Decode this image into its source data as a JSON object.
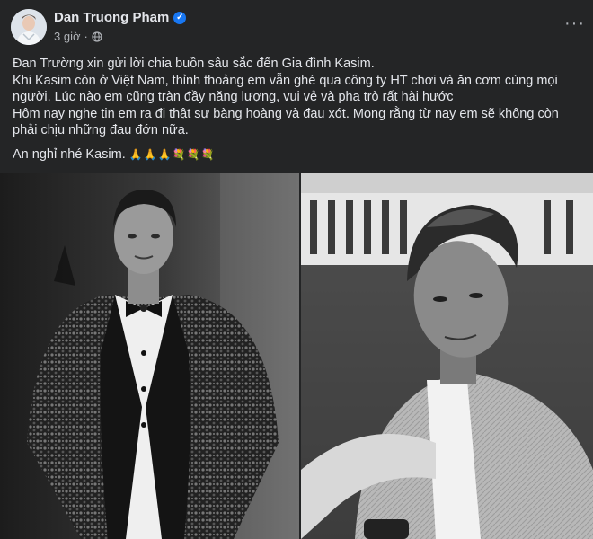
{
  "post": {
    "author": "Dan Truong Pham",
    "time": "3 giờ",
    "separator": "·",
    "more_label": "···",
    "paragraphs": [
      "Đan Trường xin gửi lời chia buồn sâu sắc đến Gia đình Kasim.",
      "Khi Kasim còn ở Việt Nam, thỉnh thoảng em vẫn ghé qua công ty HT chơi và ăn cơm cùng mọi người. Lúc nào em cũng tràn đầy năng lượng, vui vẻ và pha trò rất hài hước",
      "Hôm nay nghe tin em ra đi thật sự bàng hoàng và đau xót. Mong rằng từ nay em sẽ không còn phải chịu những đau đớn nữa."
    ],
    "closing": "An nghỉ nhé Kasim.",
    "closing_emoji": "🙏🙏🙏💐💐💐"
  },
  "icons": {
    "verified": "verified-badge-icon",
    "privacy": "globe-icon",
    "more": "more-options-icon"
  },
  "colors": {
    "background": "#242526",
    "text": "#e4e6eb",
    "secondary_text": "#b0b3b8",
    "verified": "#1877f2"
  }
}
